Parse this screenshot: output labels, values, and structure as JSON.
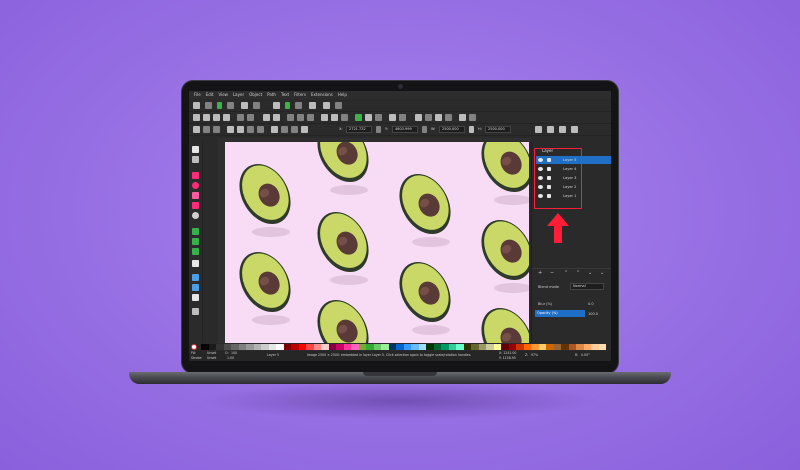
{
  "menu": [
    "File",
    "Edit",
    "View",
    "Layer",
    "Object",
    "Path",
    "Text",
    "Filters",
    "Extensions",
    "Help"
  ],
  "toolbar": {
    "x_label": "X:",
    "x_value": "2721.732",
    "y_label": "Y:",
    "y_value": "4603.999",
    "w_label": "W:",
    "w_value": "2500.000",
    "h_label": "H:",
    "h_value": "2500.000"
  },
  "layers_panel": {
    "title": "Layer",
    "layers": [
      {
        "name": "Layer 5",
        "selected": true
      },
      {
        "name": "Layer 4",
        "selected": false
      },
      {
        "name": "Layer 3",
        "selected": false
      },
      {
        "name": "Layer 2",
        "selected": false
      },
      {
        "name": "Layer 1",
        "selected": false
      }
    ],
    "blend_label": "Blend mode",
    "blend_value": "Normal",
    "blur_label": "Blur (%)",
    "blur_value": "0.0",
    "opacity_label": "Opacity (%)",
    "opacity_value": "100.0"
  },
  "status": {
    "fill_label": "Fill:",
    "fill_value": "Unset",
    "stroke_label": "Stroke:",
    "stroke_value": "Unset",
    "opacity_short": "O:",
    "opacity_value": "100",
    "stroke_width": "1.00",
    "layer_label": "Layer 5",
    "message": "Image 2500 × 2500: embedded in layer Layer 5. Click selection again to toggle scale/rotation handles.",
    "x_coord": "X: 1241.00",
    "y_coord": "Y: 1158.95",
    "zoom_label": "Z:",
    "zoom_value": "97%",
    "rotation_label": "R:",
    "rotation_value": "0.00°"
  },
  "colors": {
    "background": "#9a73e6",
    "canvas": "#f8dcf6",
    "avocado_skin": "#2f3b2a",
    "avocado_flesh": "#c9d866",
    "avocado_pit": "#5a3a36",
    "highlight": "#ff1d38",
    "selection_blue": "#1f6fc7"
  }
}
